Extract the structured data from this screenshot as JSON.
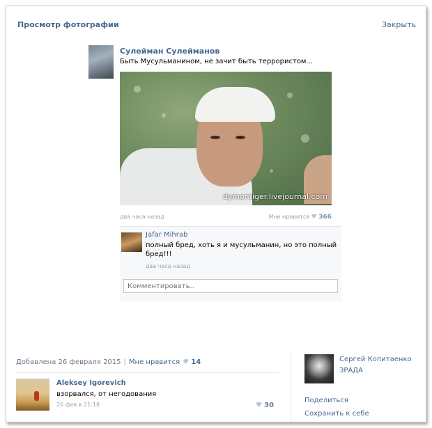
{
  "header": {
    "title": "Просмотр фотографии",
    "close": "Закрыть"
  },
  "post": {
    "author": "Сулейман Сулейманов",
    "text": "Быть Мусульманином, не зачит быть террористом...",
    "watermark": "dymontiger.livejournal.com",
    "time": "два часа назад",
    "like_label": "Мне нравится",
    "like_count": "366"
  },
  "comment": {
    "author": "Jafar Mihrab",
    "text": "полный бред, хоть я и мусульманин, но это полный бред!!!",
    "time": "два часа назад",
    "input_placeholder": "Комментировать.."
  },
  "photo_info": {
    "added": "Добавлена 26 февраля 2015",
    "separator": "|",
    "like_label": "Мне нравится",
    "like_count": "14"
  },
  "comment2": {
    "author": "Aleksey Igorevich",
    "text": "взорвался, от негодования",
    "time": "26 фев в 21:18",
    "like_count": "30"
  },
  "sidebar": {
    "owner_name": "Сергей Копитаенко",
    "owner_role": "ЗРАДА",
    "share": "Поделиться",
    "save": "Сохранить к себе"
  },
  "icons": {
    "like": "heart-icon"
  },
  "colors": {
    "link": "#45688e",
    "muted": "#9aa5b1"
  }
}
